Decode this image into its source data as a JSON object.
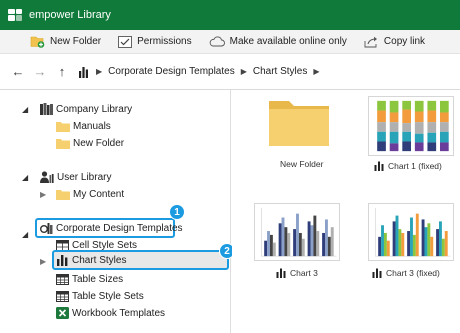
{
  "window": {
    "title": "empower Library"
  },
  "toolbar": {
    "new_folder": "New Folder",
    "permissions": "Permissions",
    "make_offline": "Make available online only",
    "copy_link": "Copy link"
  },
  "nav": {
    "crumbs": [
      "Corporate Design Templates",
      "Chart Styles"
    ]
  },
  "tree": {
    "company_library": "Company Library",
    "manuals": "Manuals",
    "new_folder": "New Folder",
    "user_library": "User Library",
    "my_content": "My Content",
    "corporate_design": "Corporate Design Templates",
    "cell_style_sets": "Cell Style Sets",
    "chart_styles": "Chart Styles",
    "table_sizes": "Table Sizes",
    "table_style_sets": "Table Style Sets",
    "workbook_templates": "Workbook Templates"
  },
  "badges": {
    "one": "1",
    "two": "2"
  },
  "tiles": [
    {
      "label": "New Folder"
    },
    {
      "label": "Chart  1 (fixed)"
    },
    {
      "label": "Chart 3"
    },
    {
      "label": "Chart 3 (fixed)"
    }
  ],
  "colors": {
    "accent": "#107a3a",
    "highlight": "#1d9be0",
    "folder": "#f6d06e"
  }
}
